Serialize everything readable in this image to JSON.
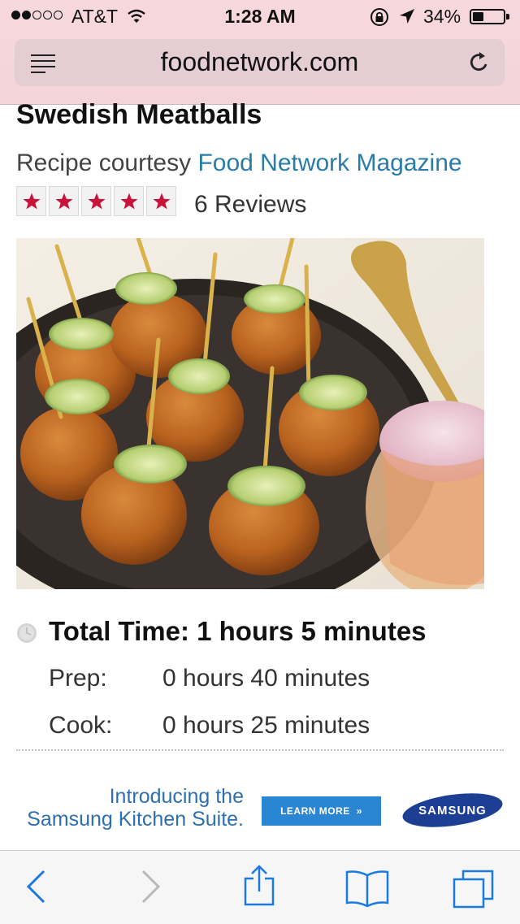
{
  "status_bar": {
    "carrier": "AT&T",
    "time": "1:28 AM",
    "battery_percent": "34%",
    "battery_level": 0.34,
    "signal_strength": 2,
    "signal_max": 5
  },
  "browser": {
    "url": "foodnetwork.com"
  },
  "recipe": {
    "title": "Swedish Meatballs",
    "courtesy_prefix": "Recipe courtesy ",
    "courtesy_source": "Food Network Magazine",
    "rating": 5,
    "reviews_label": "6 Reviews",
    "total_time_label": "Total Time: 1 hours 5 minutes",
    "prep_label": "Prep:",
    "prep_value": "0 hours 40 minutes",
    "cook_label": "Cook:",
    "cook_value": "0 hours 25 minutes"
  },
  "ad": {
    "headline_line1": "Introducing the",
    "headline_line2": "Samsung Kitchen Suite.",
    "button_label": "LEARN MORE",
    "brand": "SAMSUNG"
  },
  "colors": {
    "chrome_pink": "#f3d4d8",
    "link_blue": "#2a7ca8",
    "star_red": "#c8143c",
    "ios_blue": "#1a7ae0"
  },
  "icons": {
    "menu": "hamburger-icon",
    "reload": "reload-icon",
    "back": "back-chevron-icon",
    "forward": "forward-chevron-icon",
    "share": "share-icon",
    "bookmarks": "open-book-icon",
    "tabs": "tabs-icon"
  }
}
